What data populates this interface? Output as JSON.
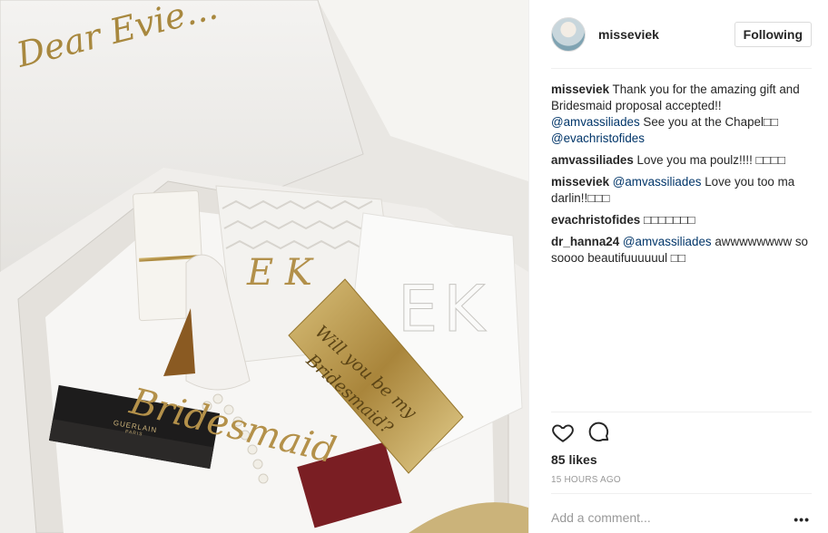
{
  "photo": {
    "box_lid_text": "Dear Evie...",
    "card_text_line1": "Will you be my",
    "card_text_line2": "Bridesmaid?",
    "robe_monogram": "EK",
    "towel_monogram": "E K",
    "gold_script": "Bridesmaid",
    "lipstick_brand": "GUERLAIN",
    "lipstick_sub": "PARIS"
  },
  "header": {
    "username": "misseviek",
    "follow_label": "Following"
  },
  "comments": [
    {
      "user": "misseviek",
      "parts": [
        {
          "t": "text",
          "v": " Thank you for the amazing gift and Bridesmaid proposal accepted!! "
        },
        {
          "t": "mention",
          "v": "@amvassiliades"
        },
        {
          "t": "text",
          "v": " See you at the Chapel□□ "
        },
        {
          "t": "mention",
          "v": "@evachristofides"
        }
      ]
    },
    {
      "user": "amvassiliades",
      "parts": [
        {
          "t": "text",
          "v": " Love you ma poulz!!!! □□□□"
        }
      ]
    },
    {
      "user": "misseviek",
      "parts": [
        {
          "t": "text",
          "v": " "
        },
        {
          "t": "mention",
          "v": "@amvassiliades"
        },
        {
          "t": "text",
          "v": " Love you too ma darlin!!□□□"
        }
      ]
    },
    {
      "user": "evachristofides",
      "parts": [
        {
          "t": "text",
          "v": " □□□□□□□"
        }
      ]
    },
    {
      "user": "dr_hanna24",
      "parts": [
        {
          "t": "text",
          "v": " "
        },
        {
          "t": "mention",
          "v": "@amvassiliades"
        },
        {
          "t": "text",
          "v": " awwwwwwww so soooo beautifuuuuuul □□"
        }
      ]
    }
  ],
  "icons": {
    "like": "heart-icon",
    "comment": "comment-bubble-icon",
    "more": "more-options-icon"
  },
  "likes_label": "85 likes",
  "time_label": "15 HOURS AGO",
  "add_comment_placeholder": "Add a comment...",
  "more_label": "•••",
  "colors": {
    "mention": "#003569",
    "text": "#262626",
    "muted": "#999999",
    "gold": "#b8974a"
  }
}
